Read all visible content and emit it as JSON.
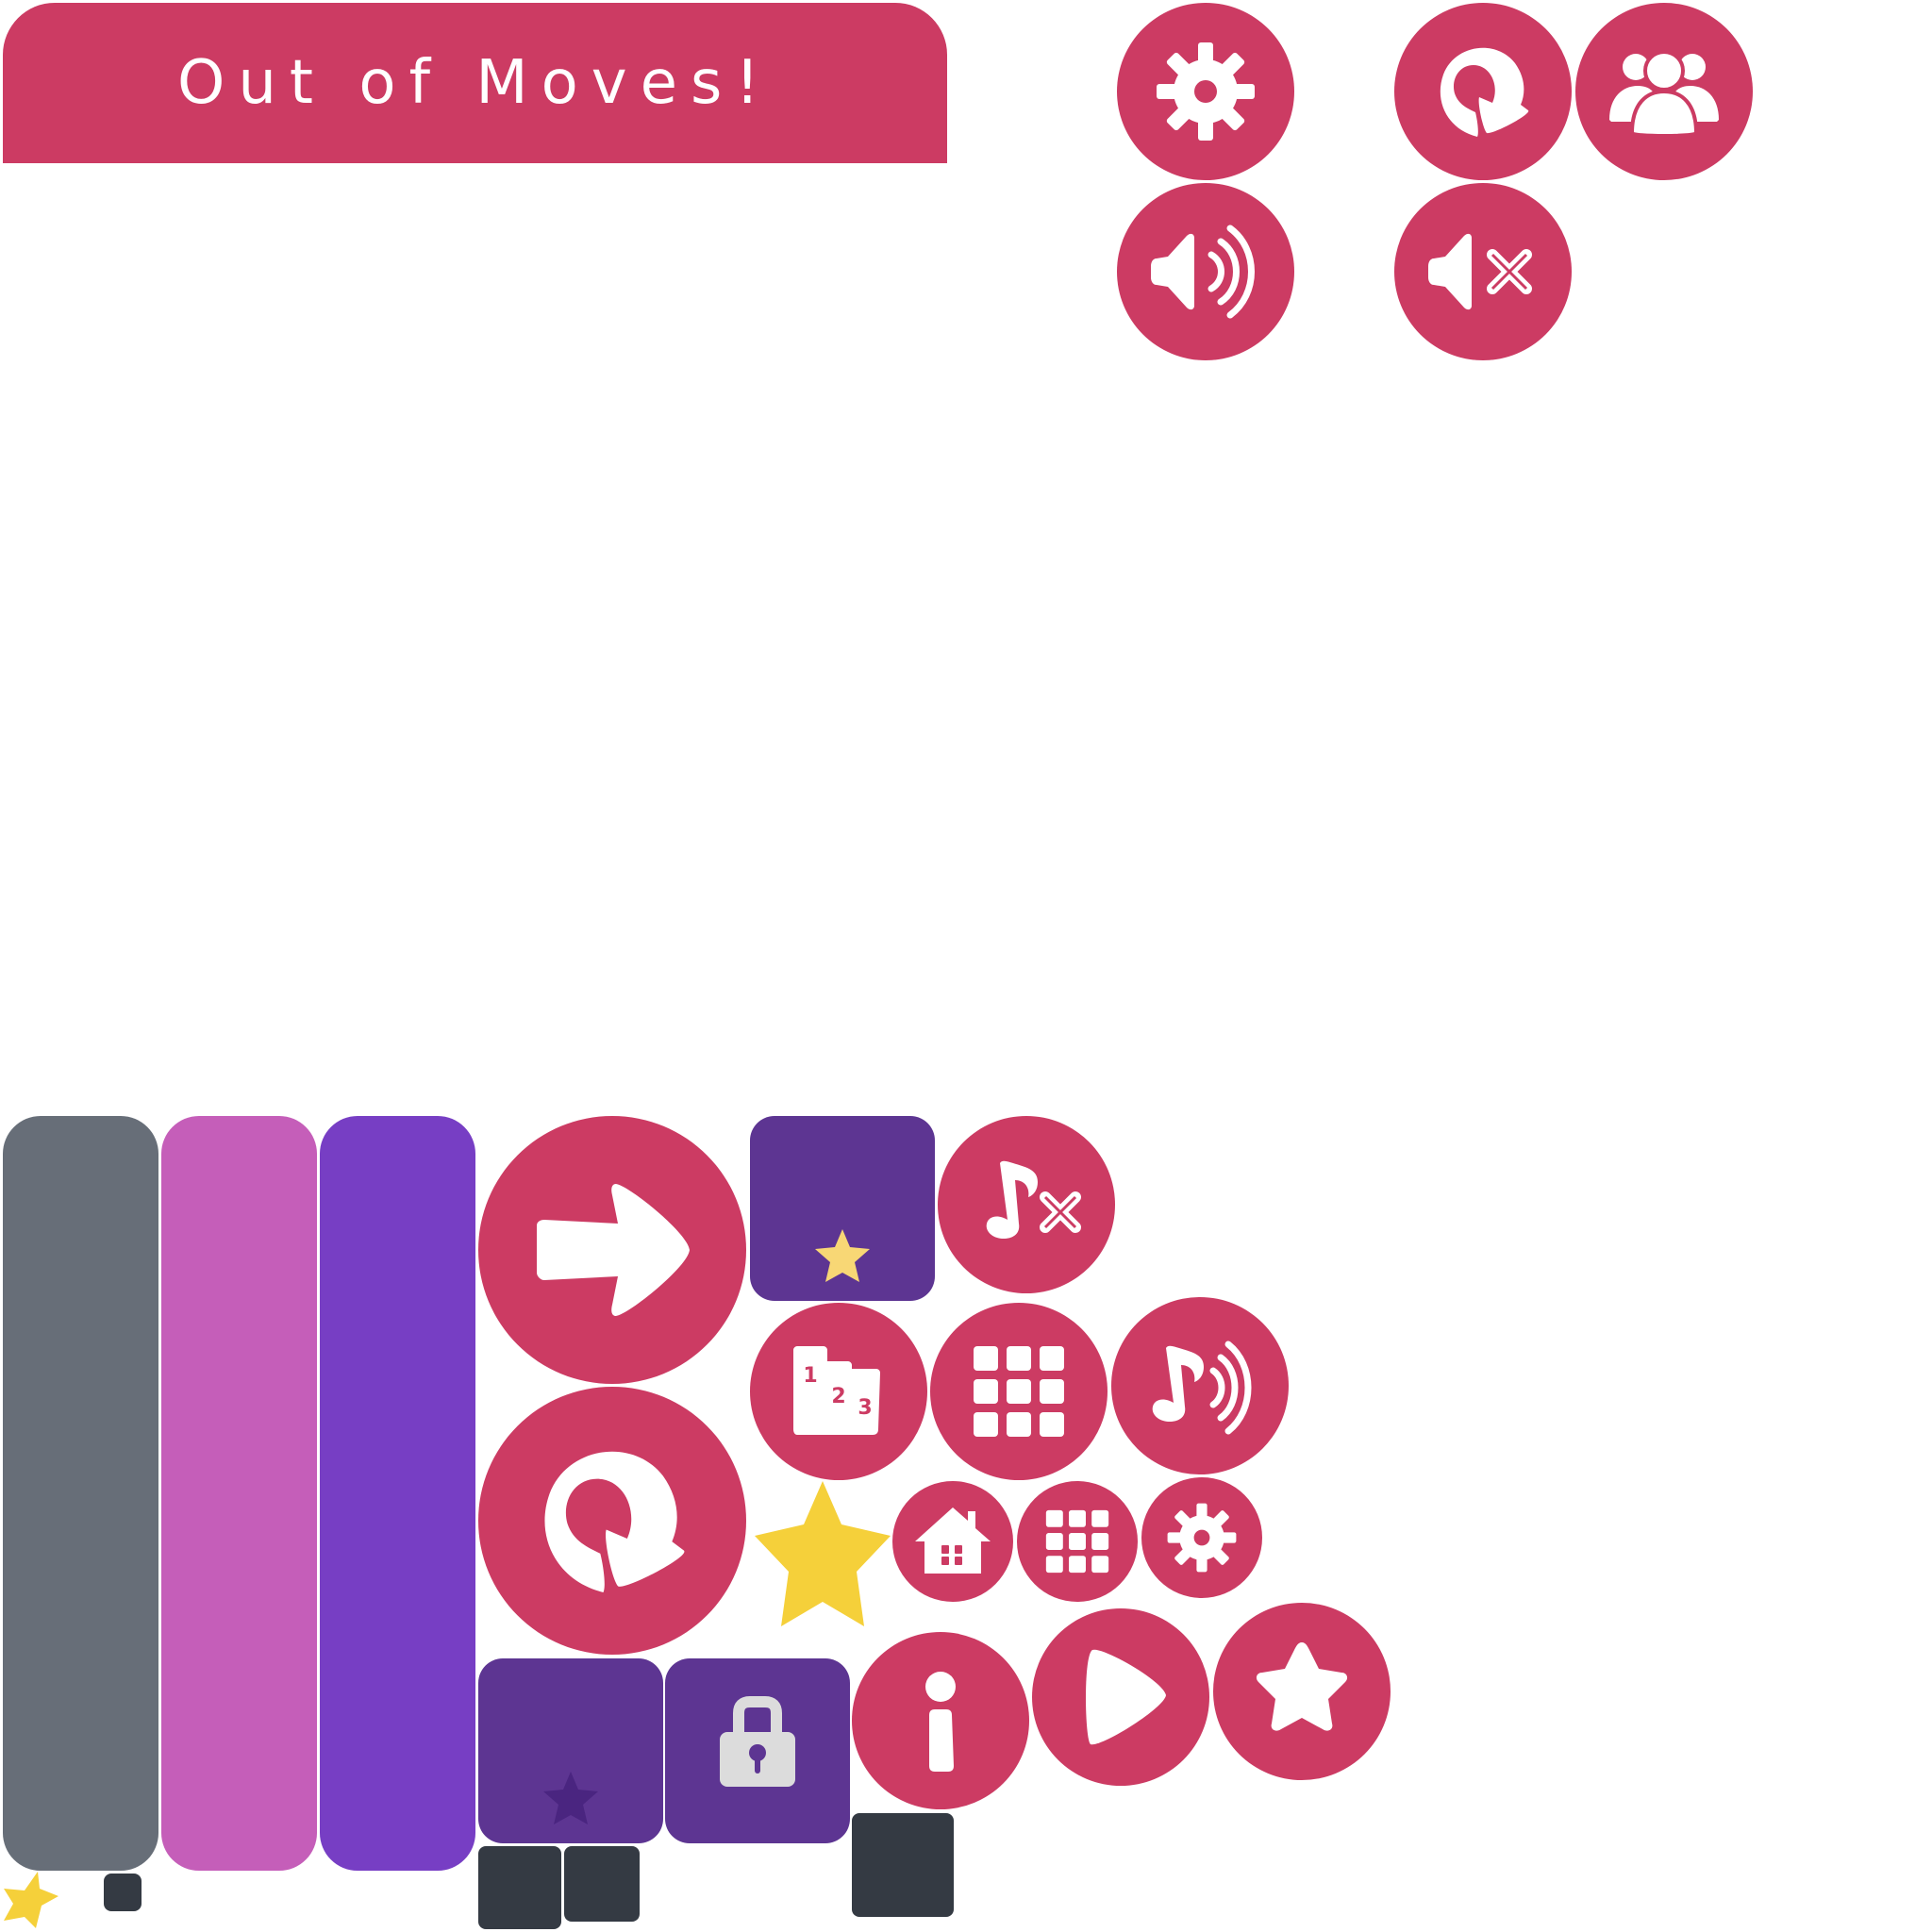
{
  "banner": {
    "title": "Out of Moves!"
  },
  "colors": {
    "brand": "#cc3b63",
    "gray_panel": "#676e78",
    "pink_panel": "#c55eb9",
    "violet_panel": "#773ec4",
    "level_tile": "#5d3592",
    "dark_square": "#343a43",
    "star_gold": "#f5d03a",
    "star_pale": "#f8d775",
    "icon_white": "#ffffff"
  },
  "buttons": [
    {
      "name": "settings-button",
      "icon": "gear-icon"
    },
    {
      "name": "restart-button",
      "icon": "restart-icon"
    },
    {
      "name": "friends-button",
      "icon": "group-icon"
    },
    {
      "name": "sound-on-button",
      "icon": "speaker-on-icon"
    },
    {
      "name": "sound-off-button",
      "icon": "speaker-muted-icon"
    },
    {
      "name": "next-button",
      "icon": "arrow-right-icon"
    },
    {
      "name": "music-off-button",
      "icon": "music-muted-icon"
    },
    {
      "name": "leaderboard-button",
      "icon": "podium-icon"
    },
    {
      "name": "level-select-button",
      "icon": "grid-icon"
    },
    {
      "name": "music-on-button",
      "icon": "music-on-icon"
    },
    {
      "name": "replay-button",
      "icon": "restart-icon"
    },
    {
      "name": "home-button",
      "icon": "home-icon"
    },
    {
      "name": "level-select-small-button",
      "icon": "grid-icon"
    },
    {
      "name": "settings-small-button",
      "icon": "gear-icon"
    },
    {
      "name": "info-button",
      "icon": "info-icon"
    },
    {
      "name": "play-button",
      "icon": "play-icon"
    },
    {
      "name": "rate-button",
      "icon": "star-icon"
    }
  ],
  "podium": {
    "first": "1",
    "second": "2",
    "third": "3"
  },
  "level_tiles": [
    {
      "state": "completed",
      "stars": 1
    },
    {
      "state": "unlocked",
      "stars": 0
    },
    {
      "state": "locked",
      "stars": 0
    }
  ]
}
